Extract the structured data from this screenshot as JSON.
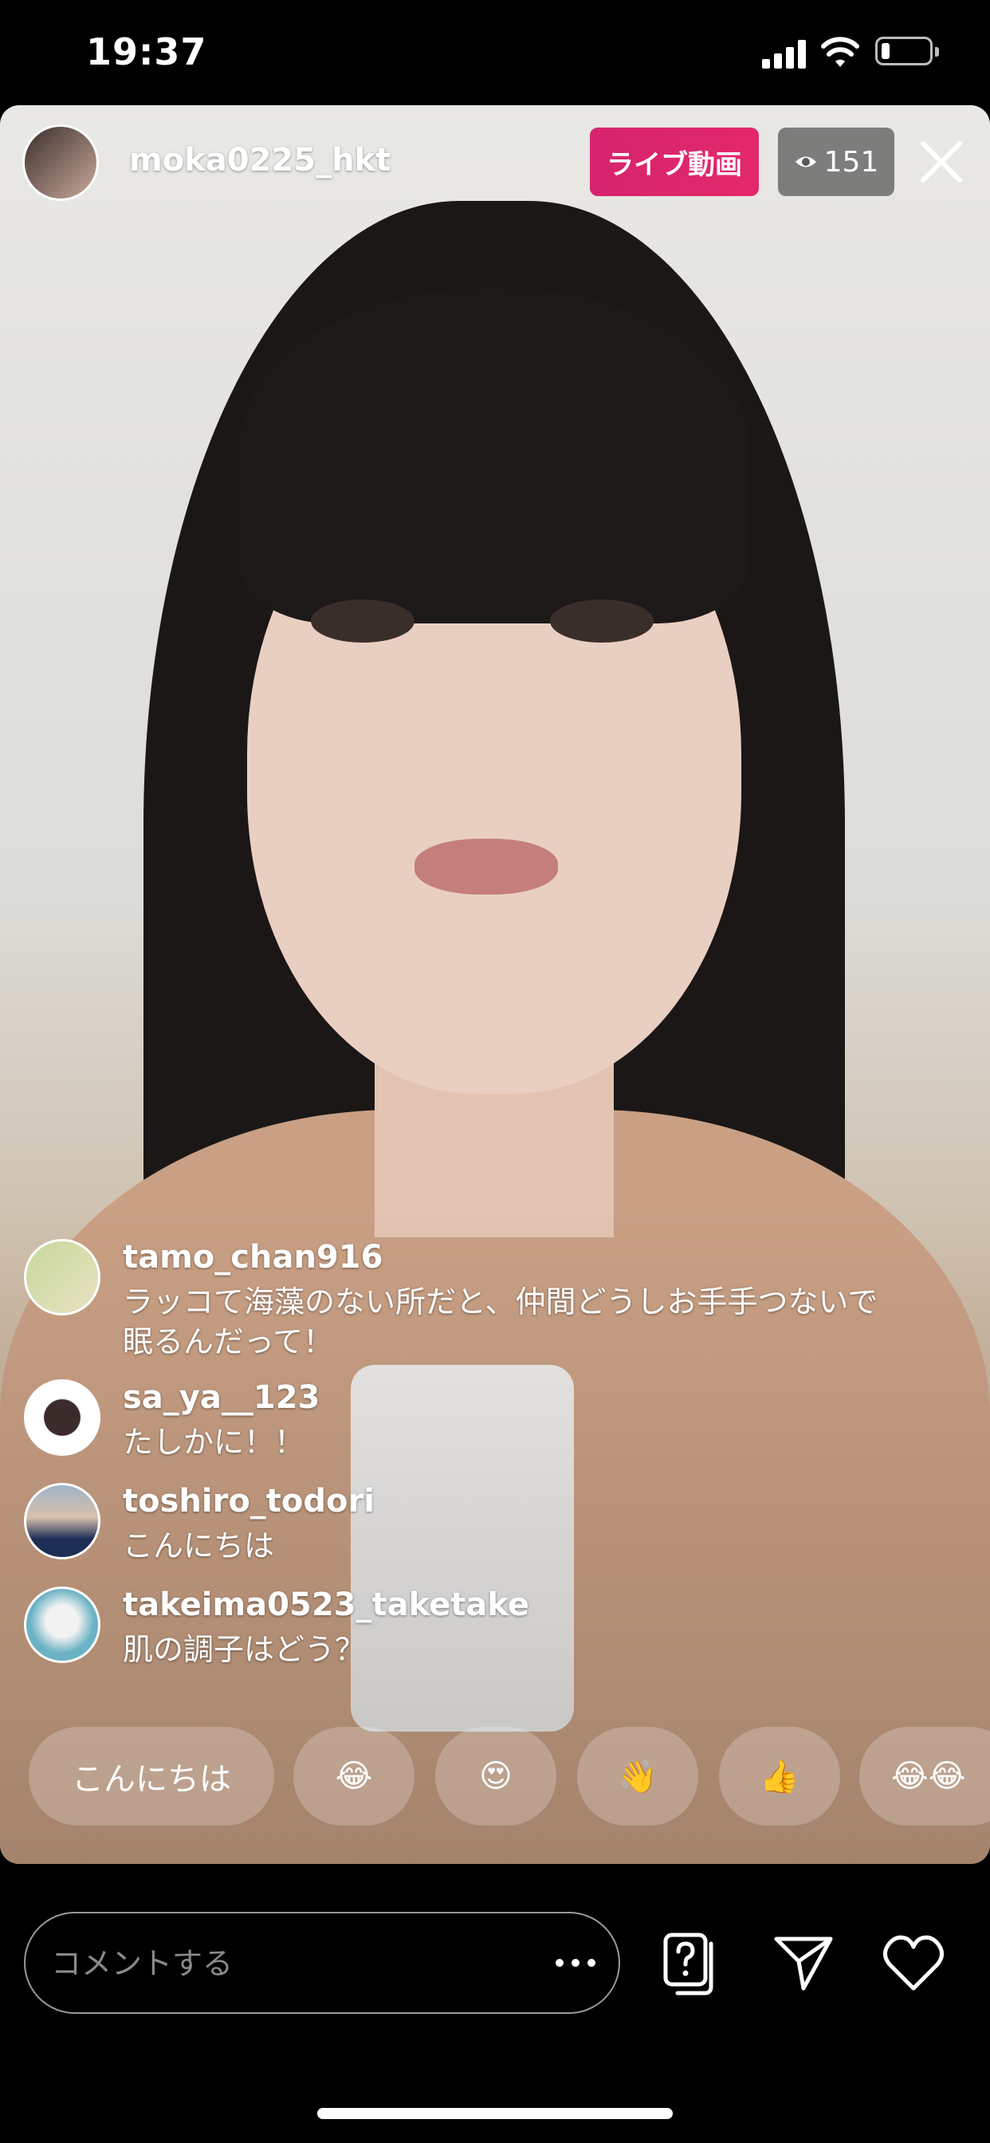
{
  "status_bar": {
    "time": "19:37"
  },
  "header": {
    "username": "moka0225_hkt",
    "live_badge": "ライブ動画",
    "viewer_count": "151"
  },
  "comments": [
    {
      "username": "tamo_chan916",
      "text": "ラッコて海藻のない所だと、仲間どうしお手手つないで眠るんだって！"
    },
    {
      "username": "sa_ya__123",
      "text": "たしかに！！"
    },
    {
      "username": "toshiro_todori",
      "text": "こんにちは"
    },
    {
      "username": "takeima0523_taketake",
      "text": "肌の調子はどう？"
    }
  ],
  "quick_reactions": [
    "こんにちは",
    "😂",
    "😍",
    "👋",
    "👍",
    "😂😂"
  ],
  "composer": {
    "placeholder": "コメントする"
  },
  "colors": {
    "live_badge": "#d6246e",
    "background": "#000000"
  }
}
